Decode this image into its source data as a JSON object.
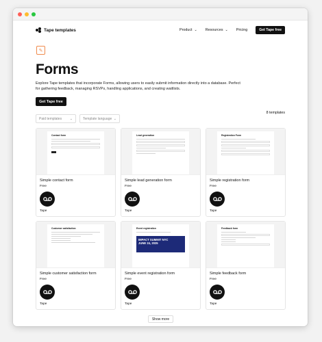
{
  "nav": {
    "brand": "Tape templates",
    "items": [
      "Product",
      "Resources",
      "Pricing"
    ],
    "cta": "Get Tape free"
  },
  "hero": {
    "title": "Forms",
    "description": "Explore Tape templates that incorporate Forms, allowing users to easily submit information directly into a database. Perfect for gathering feedback, managing RSVPs, handling applications, and creating waitlists.",
    "cta": "Get Tape free"
  },
  "filters": {
    "paid": "Paid templates",
    "language": "Template language",
    "count": "8 templates"
  },
  "cards": [
    {
      "thumb_title": "Contact form",
      "name": "Simple contact form",
      "price": "Free",
      "author": "Tape"
    },
    {
      "thumb_title": "Lead generation",
      "name": "Simple lead generation form",
      "price": "Free",
      "author": "Tape"
    },
    {
      "thumb_title": "Registration Form",
      "name": "Simple registration form",
      "price": "Free",
      "author": "Tape"
    },
    {
      "thumb_title": "Customer satisfaction",
      "name": "Simple customer satisfaction form",
      "price": "Free",
      "author": "Tape"
    },
    {
      "thumb_title": "Event registration",
      "name": "Simple event registration form",
      "price": "Free",
      "author": "Tape",
      "banner_title": "IMPACT SUMMIT NYC",
      "banner_date": "JUNE 24, 2025"
    },
    {
      "thumb_title": "Feedback form",
      "name": "Simple feedback form",
      "price": "Free",
      "author": "Tape"
    }
  ],
  "show_more": "Show more"
}
